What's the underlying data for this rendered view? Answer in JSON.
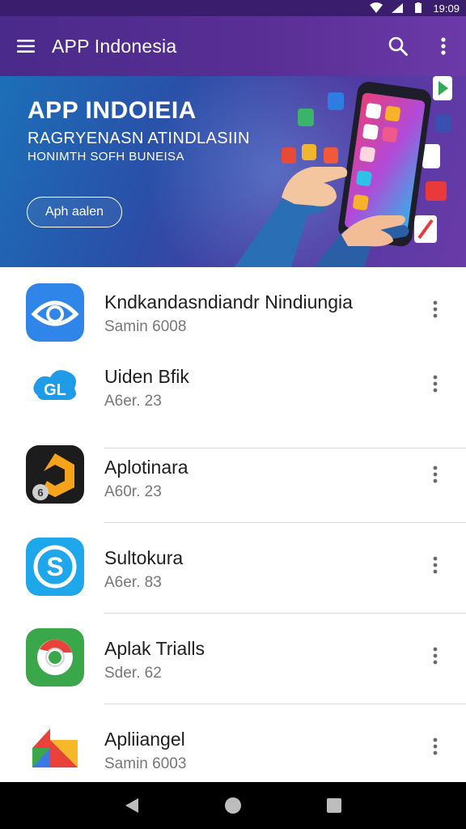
{
  "status_bar": {
    "time": "19:09"
  },
  "app_bar": {
    "title": "APP Indonesia",
    "icons": {
      "menu": "menu-icon",
      "search": "search-icon",
      "more": "more-vert-icon"
    }
  },
  "banner": {
    "title": "APP INDOIEIA",
    "subtitle": "RAGRYENASN ATINDLASIIN",
    "tagline": "HONIMTH SOFH BUNEISA",
    "button_label": "Aph aalen"
  },
  "apps": [
    {
      "name": "Kndkandasndiandr Nindiungia",
      "meta": "Samin 6008",
      "icon": "blue-eye-app-icon"
    },
    {
      "name": "Uiden Bfik",
      "meta": "A6er. 23",
      "icon": "blue-cloud-app-icon"
    },
    {
      "name": "Aplotinara",
      "meta": "A60r. 23",
      "icon": "orange-hex-app-icon"
    },
    {
      "name": "Sultokura",
      "meta": "A6er. 83",
      "icon": "blue-s-app-icon"
    },
    {
      "name": "Aplak Trialls",
      "meta": "Sder. 62",
      "icon": "chrome-app-icon"
    },
    {
      "name": "Apliiangel",
      "meta": "Samin 6003",
      "icon": "colorful-arrow-app-icon"
    }
  ],
  "nav_bar": {
    "icons": {
      "back": "back-icon",
      "home": "home-icon",
      "recents": "recents-icon"
    }
  },
  "colors": {
    "app_bar": "#4a2a8a",
    "banner_start": "#1c6fb8",
    "banner_end": "#6a3aa8"
  }
}
